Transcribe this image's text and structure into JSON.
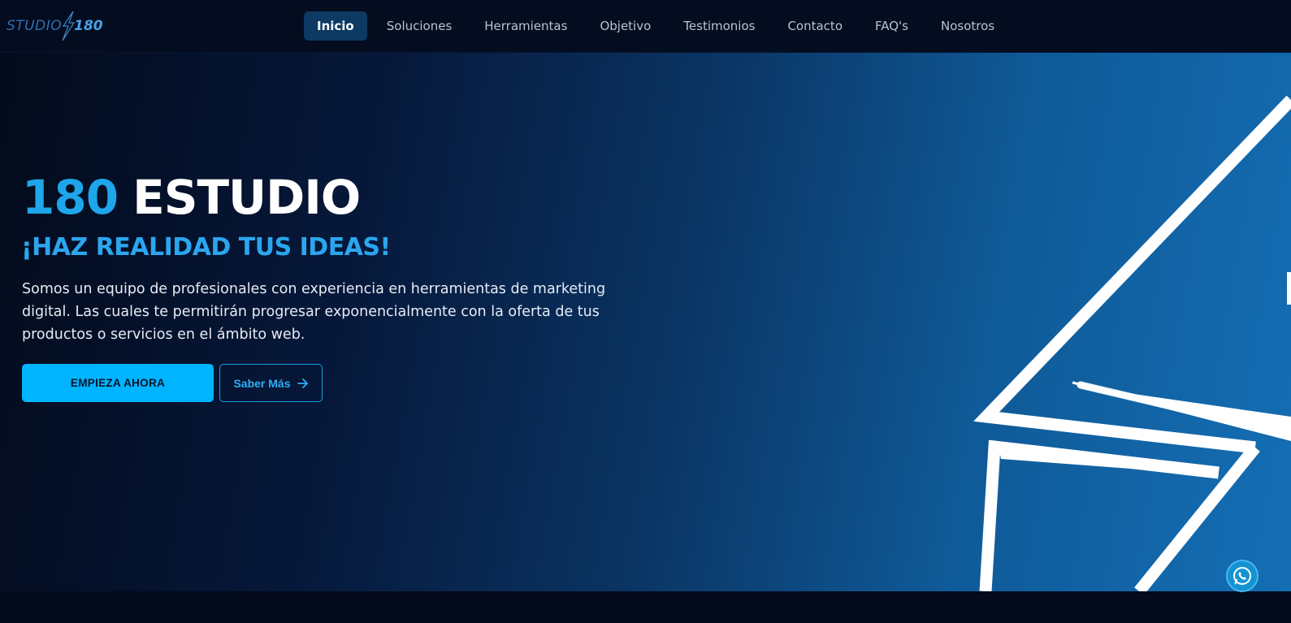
{
  "header": {
    "logo": {
      "word": "STUDIO",
      "number": "180"
    },
    "nav": [
      {
        "label": "Inicio",
        "active": true
      },
      {
        "label": "Soluciones"
      },
      {
        "label": "Herramientas"
      },
      {
        "label": "Objetivo"
      },
      {
        "label": "Testimonios"
      },
      {
        "label": "Contacto"
      },
      {
        "label": "FAQ's"
      },
      {
        "label": "Nosotros"
      }
    ]
  },
  "hero": {
    "title_number": "180",
    "title_word": "ESTUDIO",
    "subtitle": "¡HAZ REALIDAD TUS IDEAS!",
    "description": "Somos un equipo de profesionales con experiencia en herramientas de marketing digital. Las cuales te permitirán progresar exponencialmente con la oferta de tus productos o servicios en el ámbito web.",
    "primary_button": "EMPIEZA AHORA",
    "secondary_button": "Saber Más"
  },
  "icons": {
    "logo": "lightning-bolt-icon",
    "secondary_button": "arrow-right-icon",
    "floating": "whatsapp-icon"
  },
  "colors": {
    "accent": "#00b4ff",
    "accent_text": "#1ea5ea",
    "nav_active_bg": "#0d3a63",
    "background": "#030a1b"
  }
}
